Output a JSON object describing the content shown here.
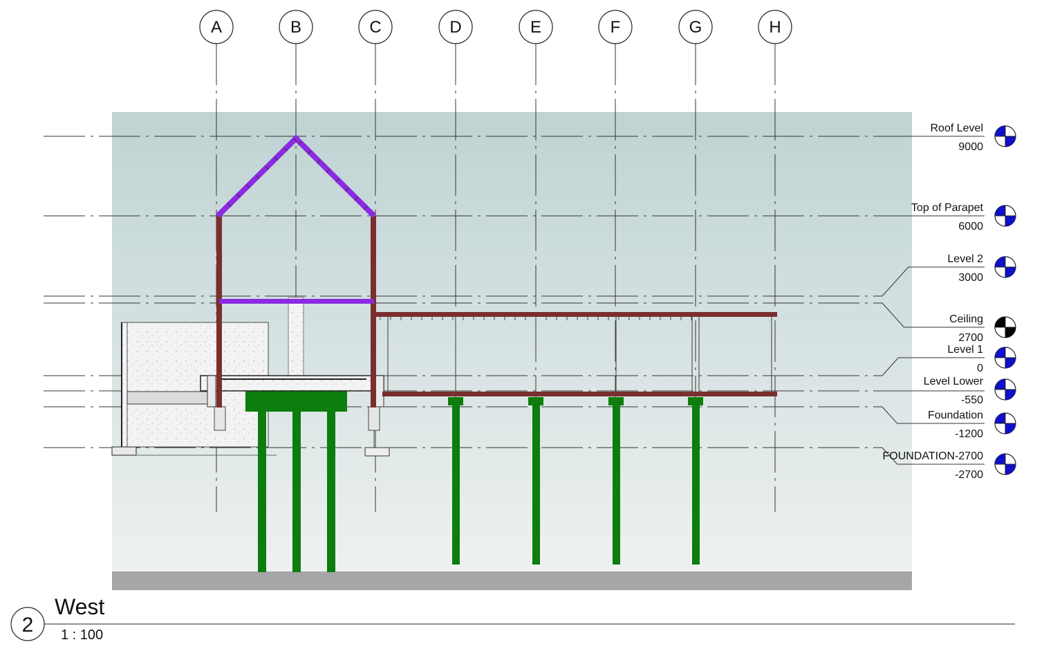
{
  "view": {
    "number": "2",
    "title": "West",
    "scale": "1 : 100"
  },
  "grids": [
    "A",
    "B",
    "C",
    "D",
    "E",
    "F",
    "G",
    "H"
  ],
  "levels": [
    {
      "name": "Roof Level",
      "elevation": "9000",
      "marker": "blue"
    },
    {
      "name": "Top of Parapet",
      "elevation": "6000",
      "marker": "blue"
    },
    {
      "name": "Level 2",
      "elevation": "3000",
      "marker": "blue"
    },
    {
      "name": "Ceiling",
      "elevation": "2700",
      "marker": "black"
    },
    {
      "name": "Level 1",
      "elevation": "0",
      "marker": "blue"
    },
    {
      "name": "Level Lower",
      "elevation": "-550",
      "marker": "blue"
    },
    {
      "name": "Foundation",
      "elevation": "-1200",
      "marker": "blue"
    },
    {
      "name": "FOUNDATION-2700",
      "elevation": "-2700",
      "marker": "blue"
    }
  ],
  "colors": {
    "sky_top": "#bfd3d3",
    "sky_bottom": "#eef1f1",
    "ground": "#a6a6a6",
    "steel": "#7a2e2e",
    "roof": "#8a2be2",
    "piles": "#0d7d0d",
    "marker_blue": "#1010c8",
    "marker_black": "#000000"
  }
}
